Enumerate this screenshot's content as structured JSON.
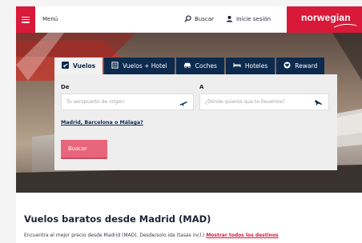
{
  "header": {
    "menu_label": "Menú",
    "search_label": "Buscar",
    "login_label": "Inicie sesión",
    "logo_text": "norwegian"
  },
  "tabs": [
    {
      "label": "Vuelos",
      "icon": "plane-icon",
      "active": true
    },
    {
      "label": "Vuelos + Hotel",
      "icon": "hotel-building-icon",
      "active": false
    },
    {
      "label": "Coches",
      "icon": "car-icon",
      "active": false
    },
    {
      "label": "Hoteles",
      "icon": "bed-icon",
      "active": false
    },
    {
      "label": "Reward",
      "icon": "reward-heart-icon",
      "active": false
    }
  ],
  "search_form": {
    "from_label": "De",
    "from_placeholder": "Tu aeropuerto de origen",
    "to_label": "A",
    "to_placeholder": "¿Dónde quieres que te llevemos?",
    "quick_links": "Madrid, Barcelona o Málaga?",
    "submit_label": "Buscar"
  },
  "content": {
    "title": "Vuelos baratos desde Madrid (MAD)",
    "subtitle": "Encuentra el mejor precio desde Madrid (MAD). Desde/solo ida (tasas incl.)",
    "show_all_link": "Mostrar todos los destinos"
  },
  "colors": {
    "brand_red": "#d81939",
    "tab_navy": "#0c2a4d",
    "button_pink": "#e9657a",
    "panel_grey": "#eeeeee"
  }
}
